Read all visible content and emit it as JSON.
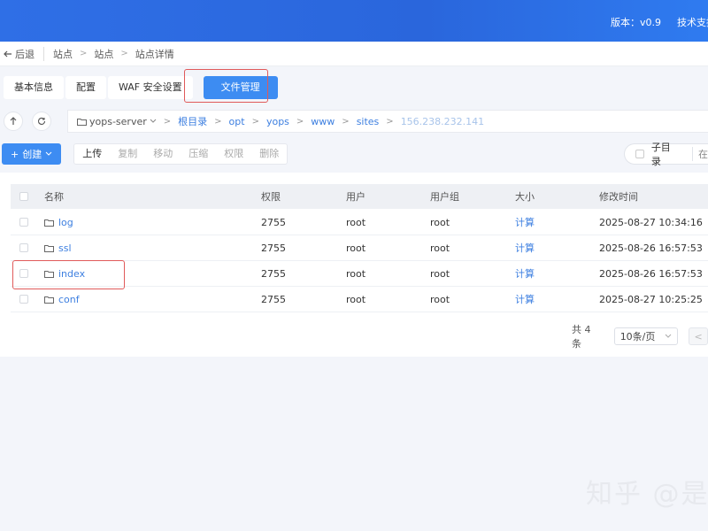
{
  "header": {
    "version": "版本：v0.9",
    "support": "技术支持"
  },
  "breadcrumb": {
    "back": "后退",
    "items": [
      "站点",
      "站点",
      "站点详情"
    ]
  },
  "tabs": [
    {
      "label": "基本信息",
      "active": false
    },
    {
      "label": "配置",
      "active": false
    },
    {
      "label": "WAF 安全设置",
      "active": false
    },
    {
      "label": "文件管理",
      "active": true
    }
  ],
  "path": {
    "server": "yops-server",
    "segments": [
      "根目录",
      "opt",
      "yops",
      "www",
      "sites"
    ],
    "current": "156.238.232.141"
  },
  "toolbar": {
    "create": "创建",
    "actions": [
      "上传",
      "复制",
      "移动",
      "压缩",
      "权限",
      "删除"
    ],
    "subdir": "子目录",
    "in": "在"
  },
  "table": {
    "headers": {
      "name": "名称",
      "perm": "权限",
      "user": "用户",
      "group": "用户组",
      "size": "大小",
      "time": "修改时间"
    },
    "rows": [
      {
        "name": "log",
        "perm": "2755",
        "user": "root",
        "group": "root",
        "size": "计算",
        "time": "2025-08-27 10:34:16"
      },
      {
        "name": "ssl",
        "perm": "2755",
        "user": "root",
        "group": "root",
        "size": "计算",
        "time": "2025-08-26 16:57:53"
      },
      {
        "name": "index",
        "perm": "2755",
        "user": "root",
        "group": "root",
        "size": "计算",
        "time": "2025-08-26 16:57:53"
      },
      {
        "name": "conf",
        "perm": "2755",
        "user": "root",
        "group": "root",
        "size": "计算",
        "time": "2025-08-27 10:25:25"
      }
    ]
  },
  "pagination": {
    "total": "共 4 条",
    "page_size": "10条/页"
  },
  "watermark": "知乎 @是",
  "colors": {
    "primary": "#3d8cf2",
    "header": "#2f6fe6",
    "highlight": "#e05a5a"
  }
}
